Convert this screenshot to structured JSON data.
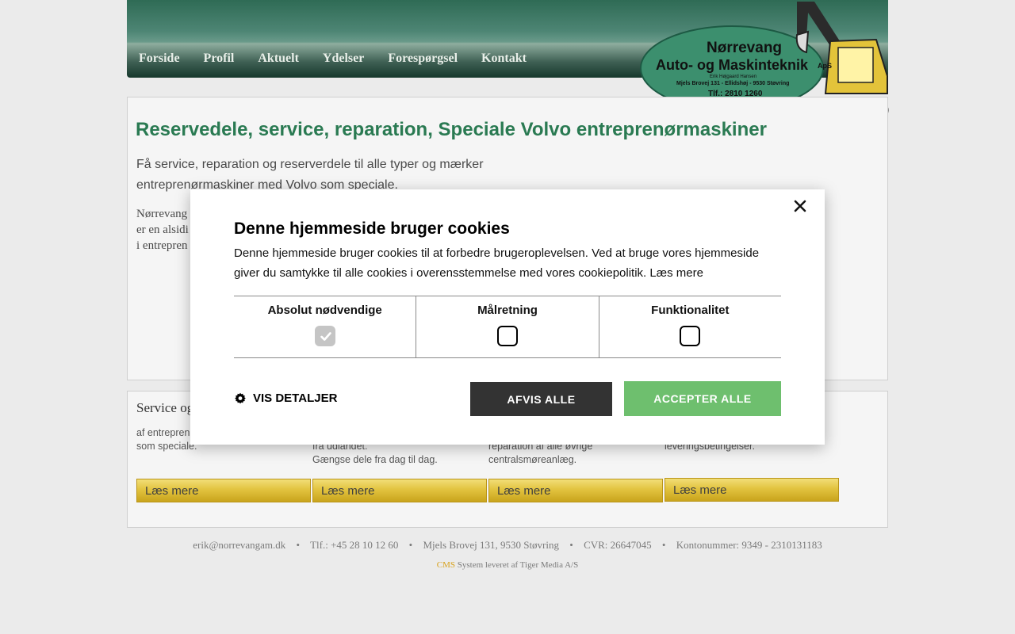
{
  "nav": {
    "items": [
      {
        "label": "Forside"
      },
      {
        "label": "Profil"
      },
      {
        "label": "Aktuelt"
      },
      {
        "label": "Ydelser"
      },
      {
        "label": "Forespørgsel"
      },
      {
        "label": "Kontakt"
      }
    ]
  },
  "logo": {
    "name_line1": "Nørrevang",
    "name_line2": "Auto- og Maskinteknik",
    "suffix": "ApS",
    "owner": "Erik Højgaard Hansen",
    "address": "Mjels Brovej 131 - Ellidshøj - 9530 Støvring",
    "phone": "Tlf.: 2810 1260"
  },
  "main": {
    "title": "Reservedele, service, reparation, Speciale Volvo entreprenørmaskiner",
    "intro": "Få service, reparation og reserverdele til alle typer og mærker entreprenørmaskiner med Volvo som speciale.",
    "body_lines": [
      "Nørrevang",
      "er en alsidi",
      "i entrepren"
    ]
  },
  "services": {
    "heading": "Service og",
    "columns": [
      {
        "text": "af entrepren\nsom speciale."
      },
      {
        "text": "fra udlandet.\nGængse dele fra dag til dag."
      },
      {
        "text": "reparation af alle øvrige\ncentralsmøreanlæg."
      },
      {
        "text": "leveringsbetingelser."
      }
    ],
    "button_label": "Læs mere"
  },
  "footer": {
    "email": "erik@norrevangam.dk",
    "phone": "Tlf.: +45 28 10 12 60",
    "address": "Mjels Brovej 131, 9530 Støvring",
    "cvr": "CVR: 26647045",
    "account": "Kontonummer: 9349 - 2310131183",
    "separator": "•",
    "cms_link": "CMS",
    "cms_text": "System leveret af Tiger Media A/S"
  },
  "cookie": {
    "title": "Denne hjemmeside bruger cookies",
    "text": "Denne hjemmeside bruger cookies til at forbedre brugeroplevelsen. Ved at bruge vores hjemmeside giver du samtykke til alle cookies i overensstemmelse med vores cookiepolitik.",
    "read_more": "Læs mere",
    "categories": [
      {
        "label": "Absolut nødvendige",
        "checked": true,
        "disabled": true
      },
      {
        "label": "Målretning",
        "checked": false,
        "disabled": false
      },
      {
        "label": "Funktionalitet",
        "checked": false,
        "disabled": false
      }
    ],
    "details_label": "VIS DETALJER",
    "decline_label": "AFVIS ALLE",
    "accept_label": "ACCEPTER ALLE"
  },
  "colors": {
    "title_green": "#2a7a52",
    "accept_green": "#6ebf6e",
    "decline_dark": "#333333",
    "button_gold": "#e2c33f"
  }
}
